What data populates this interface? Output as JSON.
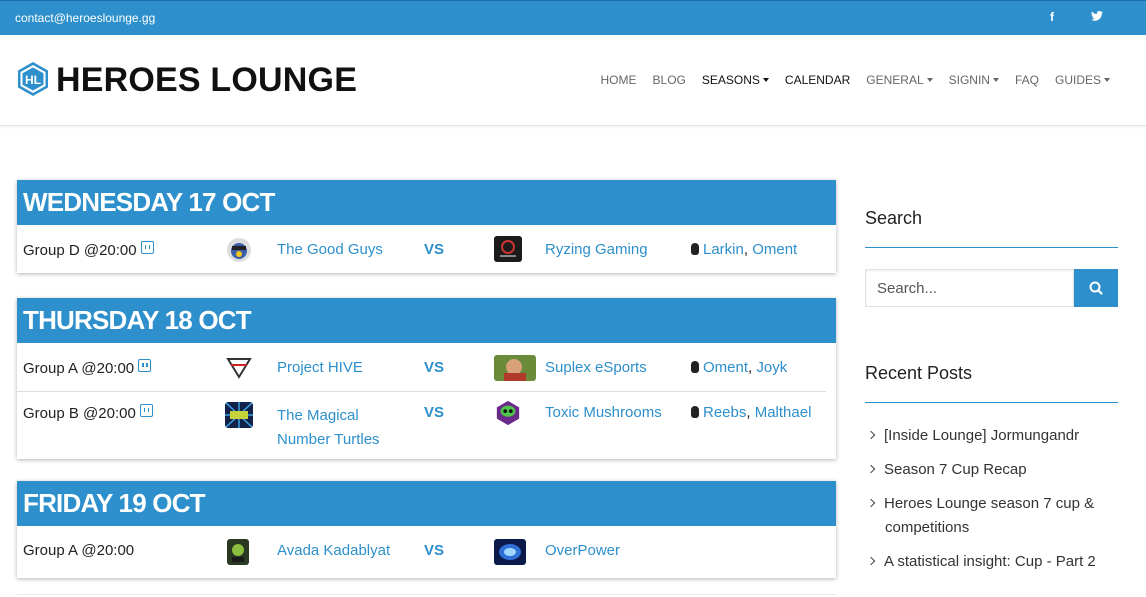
{
  "topbar": {
    "email": "contact@heroeslounge.gg",
    "social": [
      "f",
      "t"
    ]
  },
  "header": {
    "logo_text": "HEROES LOUNGE",
    "nav": [
      {
        "label": "HOME",
        "dropdown": false,
        "active": false
      },
      {
        "label": "BLOG",
        "dropdown": false,
        "active": false
      },
      {
        "label": "SEASONS",
        "dropdown": true,
        "active": true
      },
      {
        "label": "CALENDAR",
        "dropdown": false,
        "active": true
      },
      {
        "label": "GENERAL",
        "dropdown": true,
        "active": false
      },
      {
        "label": "SIGNIN",
        "dropdown": true,
        "active": false
      },
      {
        "label": "FAQ",
        "dropdown": false,
        "active": false
      },
      {
        "label": "GUIDES",
        "dropdown": true,
        "active": false
      }
    ]
  },
  "days": [
    {
      "title": "WEDNESDAY 17 OCT",
      "matches": [
        {
          "group": "Group D @20:00",
          "twitch": true,
          "team1": "The Good Guys",
          "vs": "VS",
          "team2": "Ryzing Gaming",
          "casters": [
            "Larkin",
            "Oment"
          ]
        }
      ]
    },
    {
      "title": "THURSDAY 18 OCT",
      "matches": [
        {
          "group": "Group A @20:00",
          "twitch": true,
          "team1": "Project HIVE",
          "vs": "VS",
          "team2": "Suplex eSports",
          "casters": [
            "Oment",
            "Joyk"
          ]
        },
        {
          "group": "Group B @20:00",
          "twitch": true,
          "team1_line1": "The Magical",
          "team1_line2": "Number Turtles",
          "vs": "VS",
          "team2": "Toxic Mushrooms",
          "casters": [
            "Reebs",
            "Malthael"
          ]
        }
      ]
    },
    {
      "title": "FRIDAY 19 OCT",
      "matches": [
        {
          "group": "Group A @20:00",
          "twitch": false,
          "team1": "Avada Kadablyat",
          "vs": "VS",
          "team2": "OverPower"
        }
      ]
    }
  ],
  "sidebar": {
    "search_title": "Search",
    "search_placeholder": "Search...",
    "recent_title": "Recent Posts",
    "posts": [
      "[Inside Lounge] Jormungandr",
      "Season 7 Cup Recap",
      "Heroes Lounge season 7 cup & competitions",
      "A statistical insight: Cup - Part 2"
    ]
  },
  "colors": {
    "accent": "#2d8fcb"
  }
}
